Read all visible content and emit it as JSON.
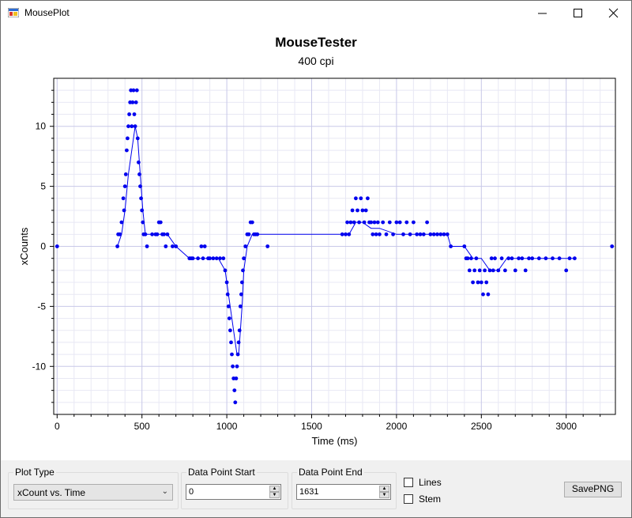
{
  "window": {
    "title": "MousePlot",
    "controls": [
      "minimize",
      "maximize",
      "close"
    ]
  },
  "chart": {
    "title": "MouseTester",
    "subtitle": "400 cpi"
  },
  "chart_data": {
    "type": "scatter",
    "xlabel": "Time (ms)",
    "ylabel": "xCounts",
    "xlim": [
      -20,
      3290
    ],
    "ylim": [
      -14,
      14
    ],
    "x_ticks": [
      0,
      500,
      1000,
      1500,
      2000,
      2500,
      3000
    ],
    "y_ticks": [
      10,
      5,
      0,
      -5,
      -10
    ],
    "grid": true,
    "series": [
      {
        "color": "#0000ee",
        "points": [
          [
            0,
            0
          ],
          [
            355,
            0
          ],
          [
            360,
            1
          ],
          [
            370,
            1
          ],
          [
            380,
            2
          ],
          [
            390,
            4
          ],
          [
            395,
            3
          ],
          [
            400,
            5
          ],
          [
            405,
            6
          ],
          [
            410,
            8
          ],
          [
            415,
            9
          ],
          [
            420,
            10
          ],
          [
            425,
            11
          ],
          [
            430,
            12
          ],
          [
            435,
            13
          ],
          [
            440,
            10
          ],
          [
            445,
            12
          ],
          [
            450,
            13
          ],
          [
            455,
            11
          ],
          [
            460,
            10
          ],
          [
            465,
            12
          ],
          [
            470,
            13
          ],
          [
            475,
            9
          ],
          [
            480,
            7
          ],
          [
            485,
            6
          ],
          [
            490,
            5
          ],
          [
            495,
            4
          ],
          [
            500,
            3
          ],
          [
            505,
            2
          ],
          [
            510,
            1
          ],
          [
            520,
            1
          ],
          [
            530,
            0
          ],
          [
            560,
            1
          ],
          [
            580,
            1
          ],
          [
            590,
            1
          ],
          [
            600,
            2
          ],
          [
            610,
            2
          ],
          [
            620,
            1
          ],
          [
            630,
            1
          ],
          [
            640,
            0
          ],
          [
            650,
            1
          ],
          [
            680,
            0
          ],
          [
            700,
            0
          ],
          [
            780,
            -1
          ],
          [
            790,
            -1
          ],
          [
            800,
            -1
          ],
          [
            830,
            -1
          ],
          [
            850,
            0
          ],
          [
            860,
            -1
          ],
          [
            870,
            0
          ],
          [
            890,
            -1
          ],
          [
            900,
            -1
          ],
          [
            920,
            -1
          ],
          [
            940,
            -1
          ],
          [
            960,
            -1
          ],
          [
            980,
            -1
          ],
          [
            990,
            -2
          ],
          [
            1000,
            -3
          ],
          [
            1005,
            -4
          ],
          [
            1010,
            -5
          ],
          [
            1015,
            -6
          ],
          [
            1020,
            -7
          ],
          [
            1025,
            -8
          ],
          [
            1030,
            -9
          ],
          [
            1035,
            -10
          ],
          [
            1040,
            -11
          ],
          [
            1045,
            -12
          ],
          [
            1050,
            -13
          ],
          [
            1055,
            -11
          ],
          [
            1060,
            -10
          ],
          [
            1065,
            -9
          ],
          [
            1070,
            -8
          ],
          [
            1075,
            -7
          ],
          [
            1080,
            -5
          ],
          [
            1085,
            -4
          ],
          [
            1090,
            -3
          ],
          [
            1095,
            -2
          ],
          [
            1100,
            -1
          ],
          [
            1110,
            0
          ],
          [
            1120,
            1
          ],
          [
            1130,
            1
          ],
          [
            1140,
            2
          ],
          [
            1150,
            2
          ],
          [
            1160,
            1
          ],
          [
            1170,
            1
          ],
          [
            1180,
            1
          ],
          [
            1240,
            0
          ],
          [
            1680,
            1
          ],
          [
            1700,
            1
          ],
          [
            1710,
            2
          ],
          [
            1720,
            1
          ],
          [
            1730,
            2
          ],
          [
            1740,
            3
          ],
          [
            1750,
            2
          ],
          [
            1760,
            4
          ],
          [
            1770,
            3
          ],
          [
            1780,
            2
          ],
          [
            1790,
            4
          ],
          [
            1800,
            3
          ],
          [
            1810,
            2
          ],
          [
            1820,
            3
          ],
          [
            1830,
            4
          ],
          [
            1840,
            2
          ],
          [
            1850,
            2
          ],
          [
            1860,
            1
          ],
          [
            1870,
            2
          ],
          [
            1880,
            1
          ],
          [
            1890,
            2
          ],
          [
            1900,
            1
          ],
          [
            1920,
            2
          ],
          [
            1940,
            1
          ],
          [
            1960,
            2
          ],
          [
            1980,
            1
          ],
          [
            2000,
            2
          ],
          [
            2020,
            2
          ],
          [
            2040,
            1
          ],
          [
            2060,
            2
          ],
          [
            2080,
            1
          ],
          [
            2100,
            2
          ],
          [
            2120,
            1
          ],
          [
            2140,
            1
          ],
          [
            2160,
            1
          ],
          [
            2180,
            2
          ],
          [
            2200,
            1
          ],
          [
            2220,
            1
          ],
          [
            2240,
            1
          ],
          [
            2260,
            1
          ],
          [
            2280,
            1
          ],
          [
            2300,
            1
          ],
          [
            2320,
            0
          ],
          [
            2400,
            0
          ],
          [
            2410,
            -1
          ],
          [
            2420,
            -1
          ],
          [
            2430,
            -2
          ],
          [
            2440,
            -1
          ],
          [
            2450,
            -3
          ],
          [
            2460,
            -2
          ],
          [
            2470,
            -1
          ],
          [
            2480,
            -3
          ],
          [
            2490,
            -2
          ],
          [
            2500,
            -3
          ],
          [
            2510,
            -4
          ],
          [
            2520,
            -2
          ],
          [
            2530,
            -3
          ],
          [
            2540,
            -4
          ],
          [
            2550,
            -2
          ],
          [
            2560,
            -1
          ],
          [
            2570,
            -2
          ],
          [
            2580,
            -1
          ],
          [
            2600,
            -2
          ],
          [
            2620,
            -1
          ],
          [
            2640,
            -2
          ],
          [
            2660,
            -1
          ],
          [
            2680,
            -1
          ],
          [
            2700,
            -2
          ],
          [
            2720,
            -1
          ],
          [
            2740,
            -1
          ],
          [
            2760,
            -2
          ],
          [
            2780,
            -1
          ],
          [
            2800,
            -1
          ],
          [
            2840,
            -1
          ],
          [
            2880,
            -1
          ],
          [
            2920,
            -1
          ],
          [
            2960,
            -1
          ],
          [
            3000,
            -2
          ],
          [
            3020,
            -1
          ],
          [
            3050,
            -1
          ],
          [
            3270,
            0
          ]
        ],
        "line": [
          [
            355,
            0
          ],
          [
            380,
            1
          ],
          [
            400,
            3
          ],
          [
            420,
            6
          ],
          [
            440,
            8
          ],
          [
            460,
            10
          ],
          [
            475,
            9
          ],
          [
            490,
            6
          ],
          [
            505,
            3
          ],
          [
            520,
            1
          ],
          [
            560,
            1
          ],
          [
            600,
            1
          ],
          [
            650,
            1
          ],
          [
            700,
            0
          ],
          [
            780,
            -1
          ],
          [
            850,
            -1
          ],
          [
            900,
            -1
          ],
          [
            950,
            -1
          ],
          [
            990,
            -2
          ],
          [
            1010,
            -4
          ],
          [
            1030,
            -6
          ],
          [
            1050,
            -8
          ],
          [
            1060,
            -9
          ],
          [
            1070,
            -9
          ],
          [
            1080,
            -7
          ],
          [
            1090,
            -5
          ],
          [
            1100,
            -2
          ],
          [
            1120,
            0
          ],
          [
            1150,
            1
          ],
          [
            1200,
            1
          ],
          [
            1300,
            1
          ],
          [
            1500,
            1
          ],
          [
            1680,
            1
          ],
          [
            1720,
            1
          ],
          [
            1760,
            2
          ],
          [
            1800,
            2
          ],
          [
            1850,
            1.5
          ],
          [
            1900,
            1.5
          ],
          [
            2000,
            1
          ],
          [
            2100,
            1
          ],
          [
            2200,
            1
          ],
          [
            2300,
            1
          ],
          [
            2320,
            0
          ],
          [
            2400,
            0
          ],
          [
            2450,
            -1
          ],
          [
            2500,
            -1
          ],
          [
            2550,
            -2
          ],
          [
            2600,
            -2
          ],
          [
            2650,
            -1
          ],
          [
            2700,
            -1
          ],
          [
            2800,
            -1
          ],
          [
            2900,
            -1
          ],
          [
            3050,
            -1
          ]
        ]
      }
    ]
  },
  "controls": {
    "plot_type": {
      "label": "Plot Type",
      "value": "xCount vs. Time"
    },
    "data_point_start": {
      "label": "Data Point Start",
      "value": "0"
    },
    "data_point_end": {
      "label": "Data Point End",
      "value": "1631"
    },
    "lines": {
      "label": "Lines",
      "checked": false
    },
    "stem": {
      "label": "Stem",
      "checked": false
    },
    "save_png": {
      "label": "SavePNG"
    }
  }
}
